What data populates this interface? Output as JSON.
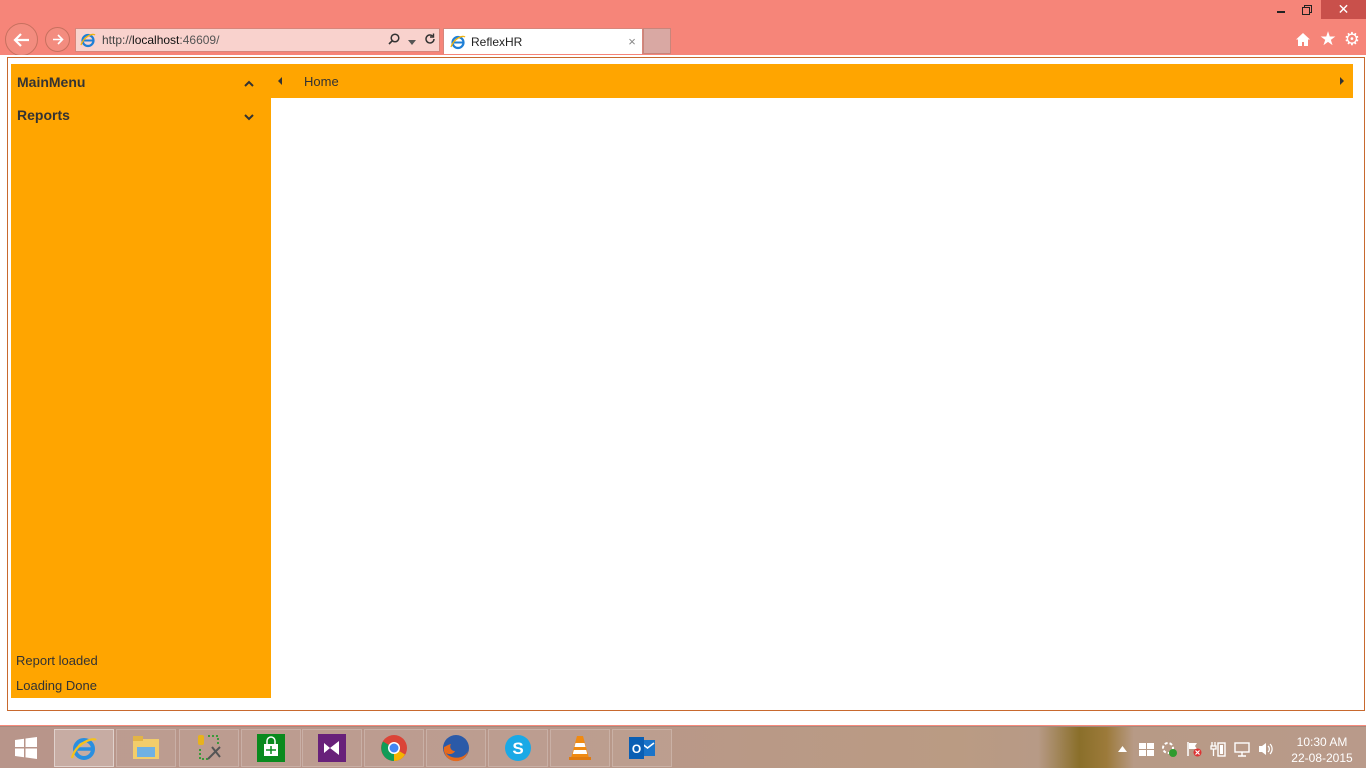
{
  "browser": {
    "window_controls": {
      "minimize": "minimize",
      "restore": "restore",
      "close": "✕"
    },
    "address_bar": {
      "scheme": "http://",
      "host": "localhost",
      "port": ":46609/",
      "search_icon": "search-icon",
      "dropdown_icon": "chevron-down-icon",
      "refresh_icon": "refresh-icon"
    },
    "tab": {
      "title": "ReflexHR",
      "close": "×"
    },
    "toolbar_icons": [
      "home-icon",
      "favorites-star-icon",
      "settings-gear-icon"
    ],
    "colors": {
      "chrome": "#f68579",
      "close_button": "#c9504b"
    }
  },
  "app": {
    "colors": {
      "accent": "#ffa500",
      "frame_border": "#c8692e",
      "text": "#333333"
    },
    "sidebar": {
      "sections": [
        {
          "label": "MainMenu",
          "state": "expanded"
        },
        {
          "label": "Reports",
          "state": "collapsed"
        }
      ],
      "status_messages": [
        "Report loaded",
        "Loading Done"
      ]
    },
    "tabstrip": {
      "tabs": [
        {
          "label": "Home"
        }
      ]
    }
  },
  "taskbar": {
    "pinned": [
      {
        "name": "Internet Explorer",
        "active": true
      },
      {
        "name": "File Explorer",
        "active": false
      },
      {
        "name": "Database Tools",
        "active": false
      },
      {
        "name": "Windows Store",
        "active": false
      },
      {
        "name": "Visual Studio",
        "active": false
      },
      {
        "name": "Google Chrome",
        "active": false
      },
      {
        "name": "Firefox",
        "active": false
      },
      {
        "name": "Skype",
        "active": false
      },
      {
        "name": "VLC",
        "active": false
      },
      {
        "name": "Outlook",
        "active": false
      }
    ],
    "tray": [
      "show-hidden-icons",
      "windows-flag",
      "sync",
      "action-center",
      "power",
      "network",
      "volume"
    ],
    "clock": {
      "time": "10:30 AM",
      "date": "22-08-2015"
    }
  }
}
